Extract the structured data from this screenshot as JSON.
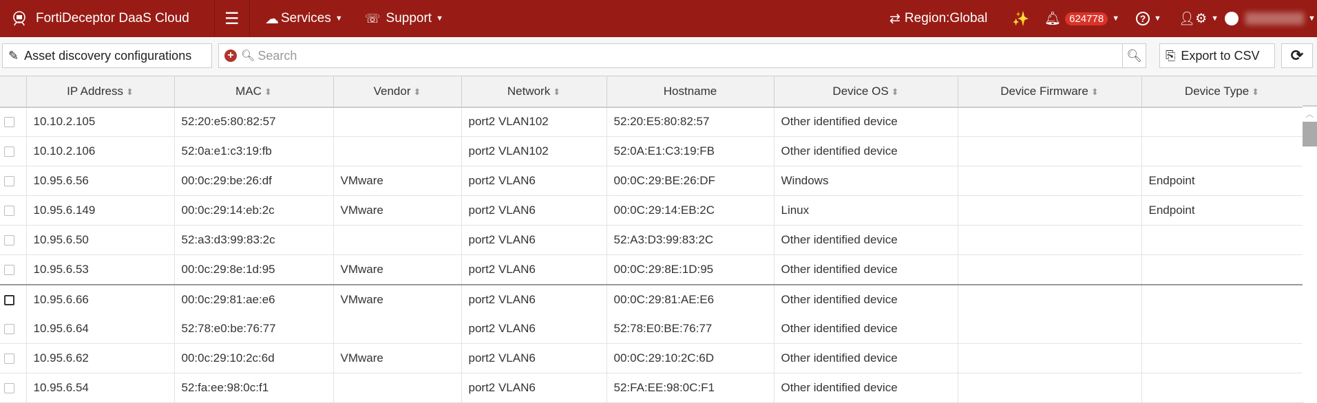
{
  "header": {
    "app_title": "FortiDeceptor DaaS Cloud",
    "services": "Services",
    "support": "Support",
    "region": "Region:Global",
    "notification_count": "624778"
  },
  "toolbar": {
    "asset_discovery": "Asset discovery configurations",
    "search_placeholder": "Search",
    "export": "Export to CSV"
  },
  "table": {
    "columns": [
      "IP Address",
      "MAC",
      "Vendor",
      "Network",
      "Hostname",
      "Device OS",
      "Device Firmware",
      "Device Type"
    ],
    "rows": [
      [
        "10.10.2.105",
        "52:20:e5:80:82:57",
        "",
        "port2 VLAN102",
        "52:20:E5:80:82:57",
        "Other identified device",
        "",
        ""
      ],
      [
        "10.10.2.106",
        "52:0a:e1:c3:19:fb",
        "",
        "port2 VLAN102",
        "52:0A:E1:C3:19:FB",
        "Other identified device",
        "",
        ""
      ],
      [
        "10.95.6.56",
        "00:0c:29:be:26:df",
        "VMware",
        "port2 VLAN6",
        "00:0C:29:BE:26:DF",
        "Windows",
        "",
        "Endpoint"
      ],
      [
        "10.95.6.149",
        "00:0c:29:14:eb:2c",
        "VMware",
        "port2 VLAN6",
        "00:0C:29:14:EB:2C",
        "Linux",
        "",
        "Endpoint"
      ],
      [
        "10.95.6.50",
        "52:a3:d3:99:83:2c",
        "",
        "port2 VLAN6",
        "52:A3:D3:99:83:2C",
        "Other identified device",
        "",
        ""
      ],
      [
        "10.95.6.53",
        "00:0c:29:8e:1d:95",
        "VMware",
        "port2 VLAN6",
        "00:0C:29:8E:1D:95",
        "Other identified device",
        "",
        ""
      ],
      [
        "10.95.6.66",
        "00:0c:29:81:ae:e6",
        "VMware",
        "port2 VLAN6",
        "00:0C:29:81:AE:E6",
        "Other identified device",
        "",
        ""
      ],
      [
        "10.95.6.64",
        "52:78:e0:be:76:77",
        "",
        "port2 VLAN6",
        "52:78:E0:BE:76:77",
        "Other identified device",
        "",
        ""
      ],
      [
        "10.95.6.62",
        "00:0c:29:10:2c:6d",
        "VMware",
        "port2 VLAN6",
        "00:0C:29:10:2C:6D",
        "Other identified device",
        "",
        ""
      ],
      [
        "10.95.6.54",
        "52:fa:ee:98:0c:f1",
        "",
        "port2 VLAN6",
        "52:FA:EE:98:0C:F1",
        "Other identified device",
        "",
        ""
      ]
    ],
    "selected_row": 6
  },
  "colors": {
    "brand": "#981c15",
    "badge": "#d8342a"
  }
}
